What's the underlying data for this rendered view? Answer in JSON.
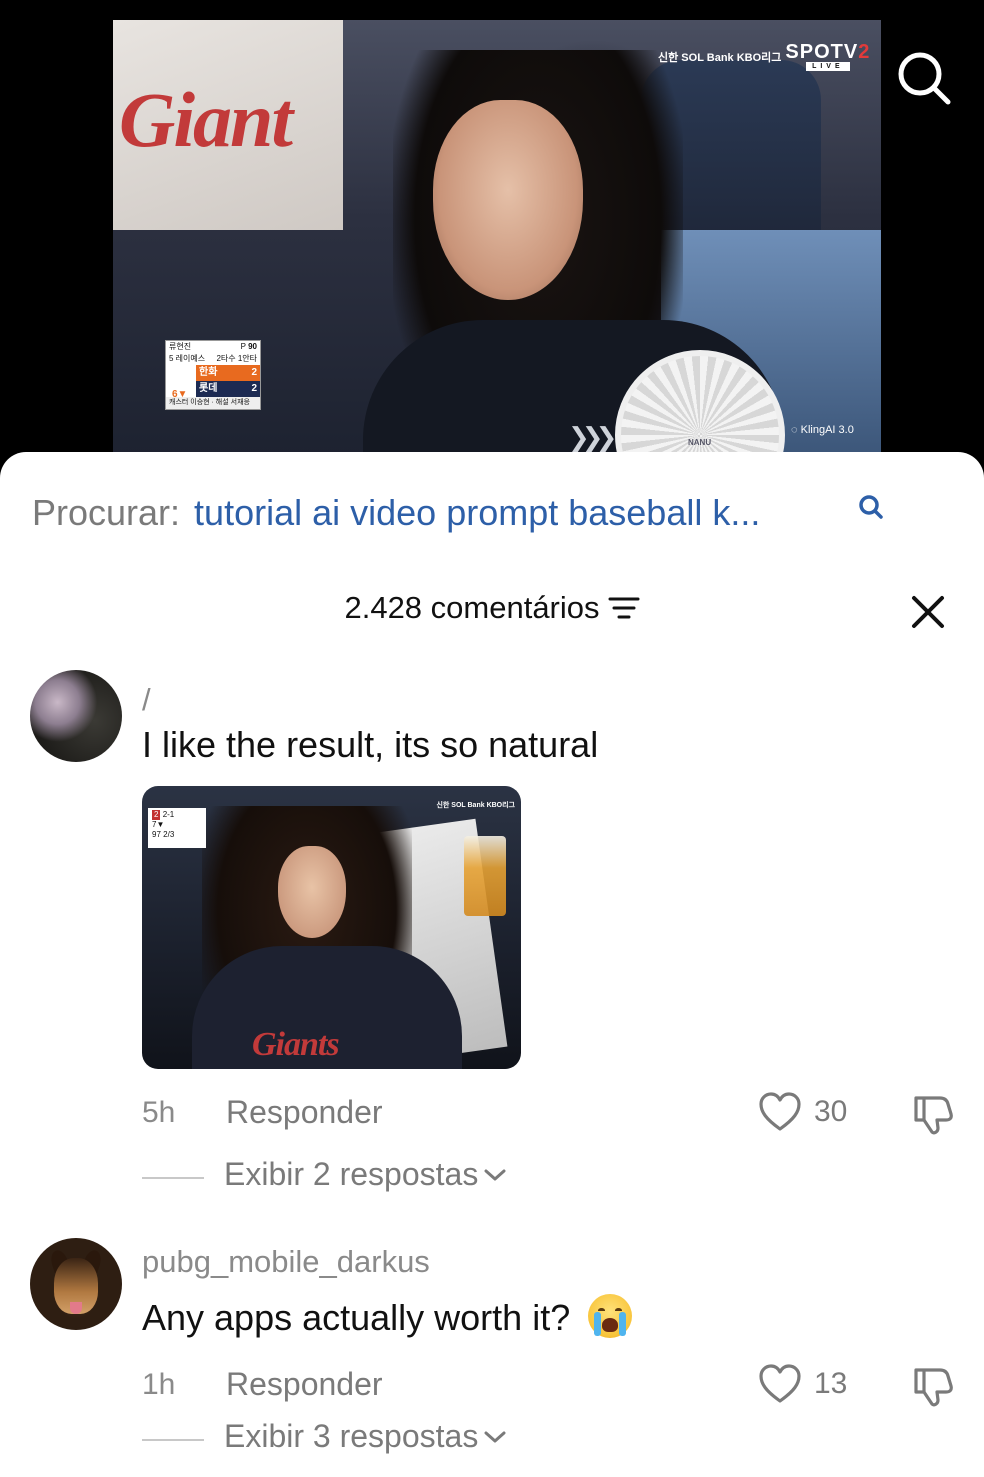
{
  "video": {
    "broadcast_bank": "신한 SOL Bank KBO리그",
    "broadcast_channel": "SPOTV",
    "broadcast_channel_num": "2",
    "live_label": "LIVE",
    "shirt_text": "Giant",
    "fan_brand": "NANU",
    "scoreboard": {
      "pitcher": "류현진",
      "pitch_label": "P",
      "pitch_count": "90",
      "batter": "5 레이예스",
      "batter_stat": "2타수 1안타",
      "team1": "한화",
      "team1_score": "2",
      "team2": "롯데",
      "team2_score": "2",
      "inning": "6▼",
      "footer": "캐스터 이승현 · 해설 서재응"
    },
    "watermark": "KlingAI 3.0"
  },
  "search_suggestion": {
    "prefix": "Procurar:",
    "query": "tutorial ai video prompt baseball k..."
  },
  "comments_header": {
    "title": "2.428 comentários"
  },
  "comments": [
    {
      "username": "/",
      "text": "I like the result, its so natural",
      "time": "5h",
      "reply_label": "Responder",
      "likes": "30",
      "replies_label": "Exibir 2 respostas",
      "image": {
        "score_top": "2-1",
        "score_inning": "7▼",
        "score_count": "97",
        "score_sub": "2/3",
        "bank": "신한 SOL Bank KBO리그",
        "jersey_text": "Giants"
      }
    },
    {
      "username": "pubg_mobile_darkus",
      "text": "Any apps actually worth it?",
      "time": "1h",
      "reply_label": "Responder",
      "likes": "13",
      "replies_label": "Exibir 3 respostas"
    }
  ],
  "colors": {
    "link_blue": "#2d5fa8",
    "muted_gray": "#7a7a7a",
    "text": "#111111"
  },
  "icons": [
    "search-icon",
    "filter-icon",
    "close-icon",
    "heart-icon",
    "dislike-icon",
    "chevron-down-icon",
    "crying-face-emoji"
  ]
}
